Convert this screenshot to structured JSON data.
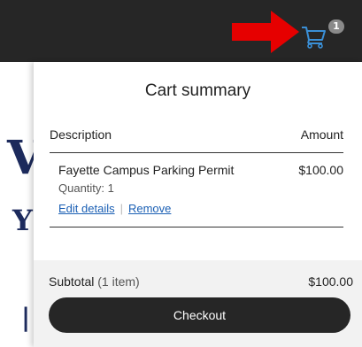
{
  "header": {
    "cart_count": "1"
  },
  "background_text": {
    "fragment_1": "V",
    "fragment_2": "Y",
    "fragment_3": "|"
  },
  "cart": {
    "title": "Cart summary",
    "columns": {
      "description": "Description",
      "amount": "Amount"
    },
    "items": [
      {
        "name": "Fayette Campus Parking Permit",
        "quantity": "Quantity: 1",
        "price": "$100.00",
        "edit_label": "Edit details",
        "remove_label": "Remove"
      }
    ],
    "subtotal_label": "Subtotal",
    "subtotal_count": "(1 item)",
    "subtotal_amount": "$100.00",
    "checkout_label": "Checkout"
  },
  "colors": {
    "topbar": "#262626",
    "cart_icon": "#3a8fd6",
    "link": "#1a5fb4",
    "arrow": "#e60000"
  },
  "icons": {
    "cart": "shopping-cart-icon",
    "annotation": "red-arrow-annotation"
  }
}
